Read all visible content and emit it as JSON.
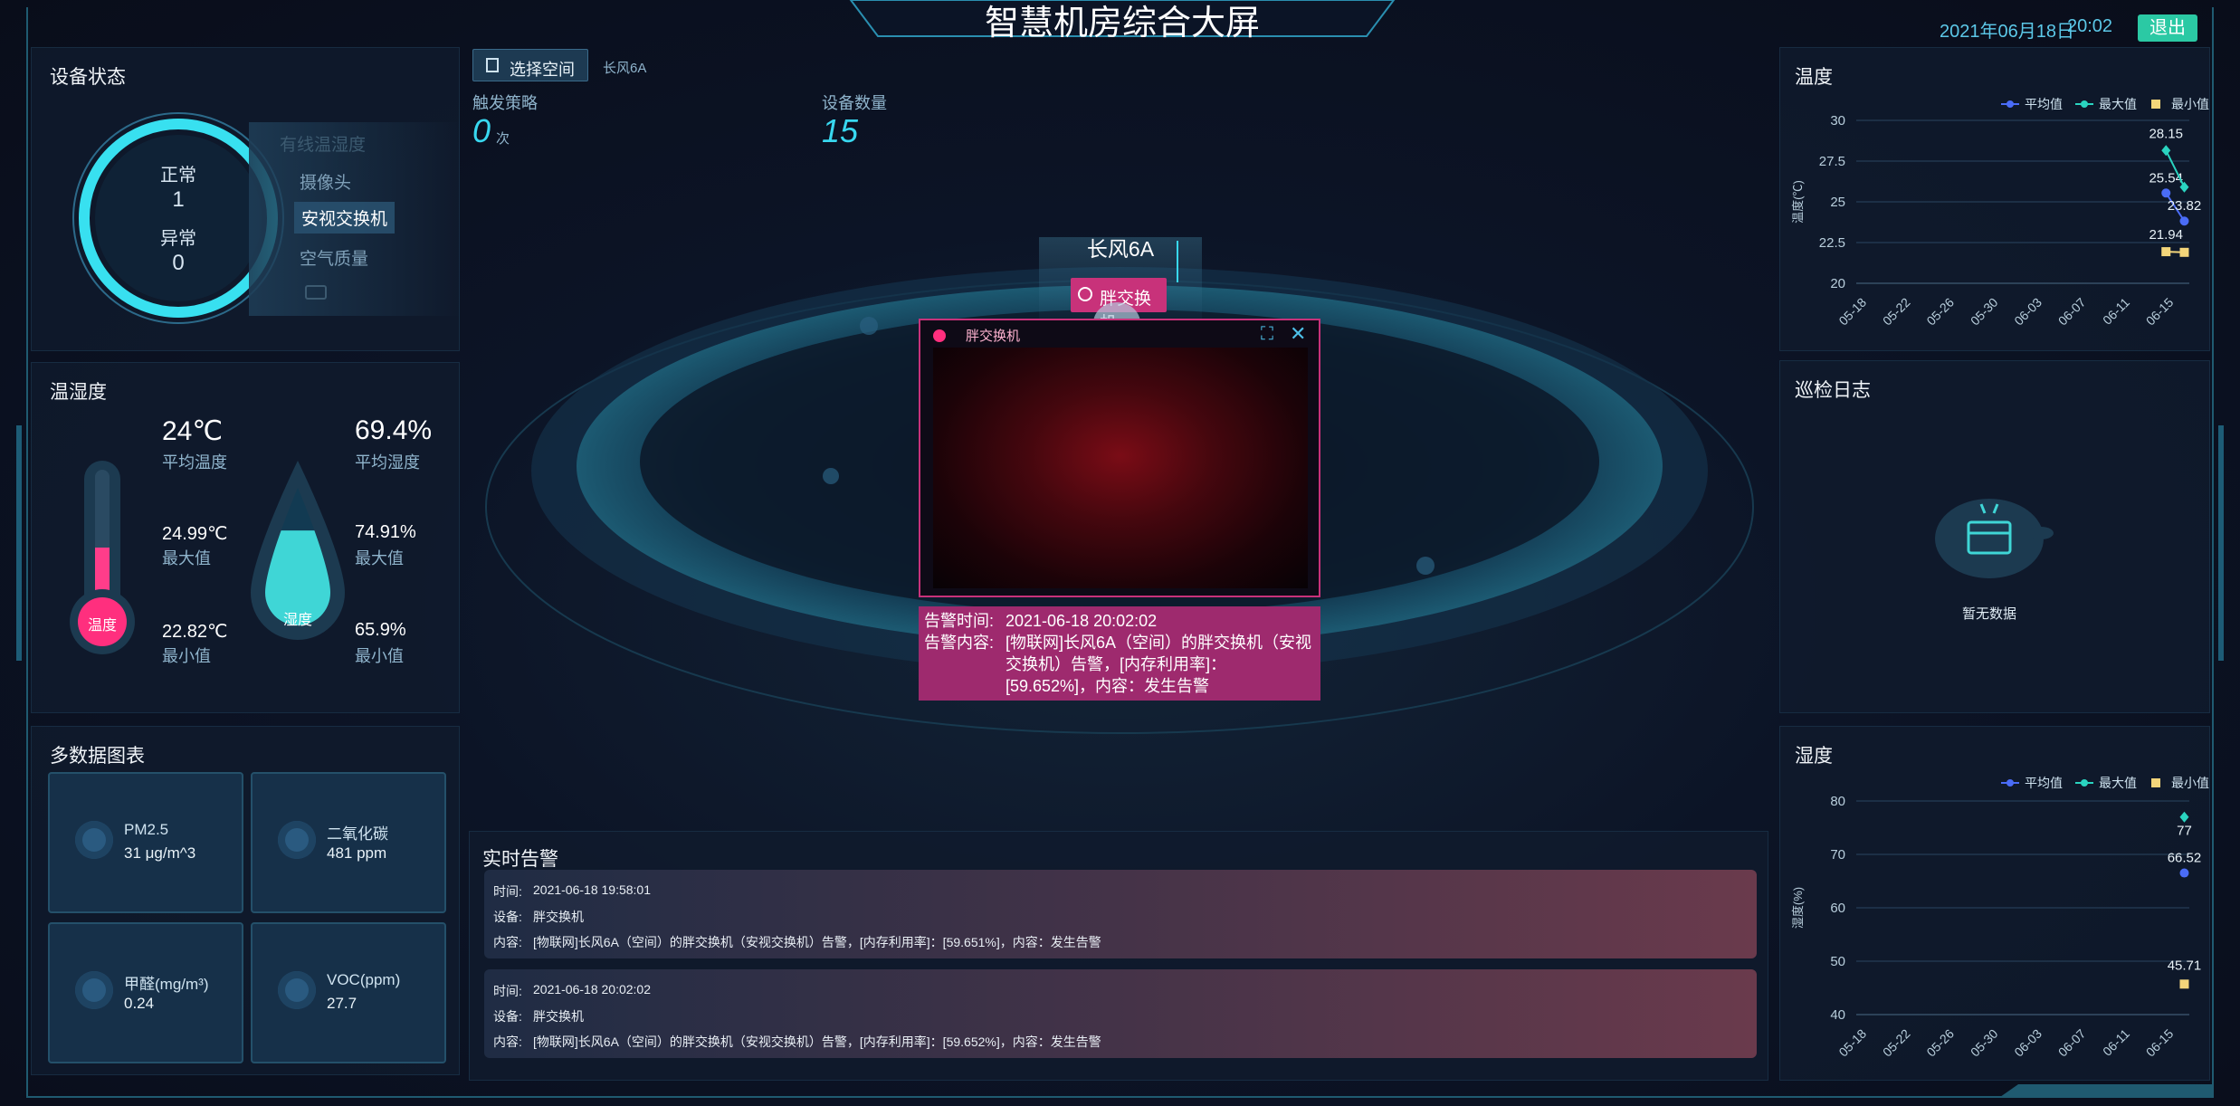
{
  "header": {
    "title": "智慧机房综合大屏",
    "date": "2021年06月18日",
    "time": "20:02",
    "exit_label": "退出"
  },
  "device_status": {
    "title": "设备状态",
    "normal_label": "正常",
    "normal_count": "1",
    "abnormal_label": "异常",
    "abnormal_count": "0",
    "device_types": [
      "有线温湿度",
      "摄像头",
      "安视交换机",
      "空气质量"
    ],
    "active_index": 2
  },
  "temp_humidity": {
    "title": "温湿度",
    "temp": {
      "avg": "24℃",
      "avg_label": "平均温度",
      "max": "24.99℃",
      "max_label": "最大值",
      "min": "22.82℃",
      "min_label": "最小值",
      "bulb_label": "温度"
    },
    "humidity": {
      "avg": "69.4%",
      "avg_label": "平均湿度",
      "max": "74.91%",
      "max_label": "最大值",
      "min": "65.9%",
      "min_label": "最小值",
      "drop_label": "湿度",
      "level": 0.69
    }
  },
  "multi_data": {
    "title": "多数据图表",
    "cards": [
      {
        "name": "PM2.5",
        "value": "31 μg/m^3",
        "icon": "pm25-icon"
      },
      {
        "name": "二氧化碳",
        "value": "481 ppm",
        "icon": "cloud-icon"
      },
      {
        "name": "甲醛(mg/m³)",
        "value": "0.24",
        "icon": "warning-icon"
      },
      {
        "name": "VOC(ppm)",
        "value": "27.7",
        "icon": "voc-icon"
      }
    ]
  },
  "center": {
    "select_space_label": "选择空间",
    "current_space": "长风6A",
    "trigger_label": "触发策略",
    "trigger_value": "0",
    "trigger_unit": "次",
    "device_count_label": "设备数量",
    "device_count_value": "15",
    "room_label": "长风6A",
    "alert_chip": "胖交换机",
    "popup": {
      "title": "胖交换机",
      "time_label": "告警时间:",
      "time_value": "2021-06-18 20:02:02",
      "content_label": "告警内容:",
      "content_value": "[物联网]长风6A（空间）的胖交换机（安视交换机）告警，[内存利用率]：[59.652%]，内容：发生告警"
    }
  },
  "realtime_alarm": {
    "title": "实时告警",
    "items": [
      {
        "time_label": "时间:",
        "time": "2021-06-18 19:58:01",
        "device_label": "设备:",
        "device": "胖交换机",
        "content_label": "内容:",
        "content": "[物联网]长风6A（空间）的胖交换机（安视交换机）告警，[内存利用率]：[59.651%]，内容：发生告警"
      },
      {
        "time_label": "时间:",
        "time": "2021-06-18 20:02:02",
        "device_label": "设备:",
        "device": "胖交换机",
        "content_label": "内容:",
        "content": "[物联网]长风6A（空间）的胖交换机（安视交换机）告警，[内存利用率]：[59.652%]，内容：发生告警"
      }
    ]
  },
  "inspection_log": {
    "title": "巡检日志",
    "empty_text": "暂无数据"
  },
  "colors": {
    "avg": "#4a6cf7",
    "max": "#2ad4c0",
    "min": "#f3d57a",
    "accent": "#33c7e0",
    "alarm": "#d6337a"
  },
  "chart_data": [
    {
      "type": "line",
      "title": "温度",
      "ylabel": "温度(℃)",
      "ylim": [
        20,
        30
      ],
      "yticks": [
        20,
        22.5,
        25,
        27.5,
        30
      ],
      "categories": [
        "05-18",
        "05-22",
        "05-26",
        "05-30",
        "06-03",
        "06-07",
        "06-11",
        "06-15"
      ],
      "legend": [
        "平均值",
        "最大值",
        "最小值"
      ],
      "legend_position": "top-right",
      "series": [
        {
          "name": "平均值",
          "points": [
            [
              0.93,
              25.54
            ],
            [
              0.985,
              23.82
            ]
          ],
          "labels": [
            "25.54",
            "23.82"
          ]
        },
        {
          "name": "最大值",
          "points": [
            [
              0.93,
              28.15
            ],
            [
              0.985,
              25.9
            ]
          ],
          "labels": [
            "28.15",
            ""
          ]
        },
        {
          "name": "最小值",
          "points": [
            [
              0.93,
              21.94
            ],
            [
              0.985,
              21.9
            ]
          ],
          "labels": [
            "21.94",
            ""
          ]
        }
      ]
    },
    {
      "type": "line",
      "title": "湿度",
      "ylabel": "湿度(%)",
      "ylim": [
        40,
        80
      ],
      "yticks": [
        40,
        50,
        60,
        70,
        80
      ],
      "categories": [
        "05-18",
        "05-22",
        "05-26",
        "05-30",
        "06-03",
        "06-07",
        "06-11",
        "06-15"
      ],
      "legend": [
        "平均值",
        "最大值",
        "最小值"
      ],
      "legend_position": "top-right",
      "series": [
        {
          "name": "平均值",
          "points": [
            [
              0.985,
              66.52
            ]
          ],
          "labels": [
            "66.52"
          ]
        },
        {
          "name": "最大值",
          "points": [
            [
              0.985,
              77
            ]
          ],
          "labels": [
            "77"
          ]
        },
        {
          "name": "最小值",
          "points": [
            [
              0.985,
              45.71
            ]
          ],
          "labels": [
            "45.71"
          ]
        }
      ]
    }
  ]
}
